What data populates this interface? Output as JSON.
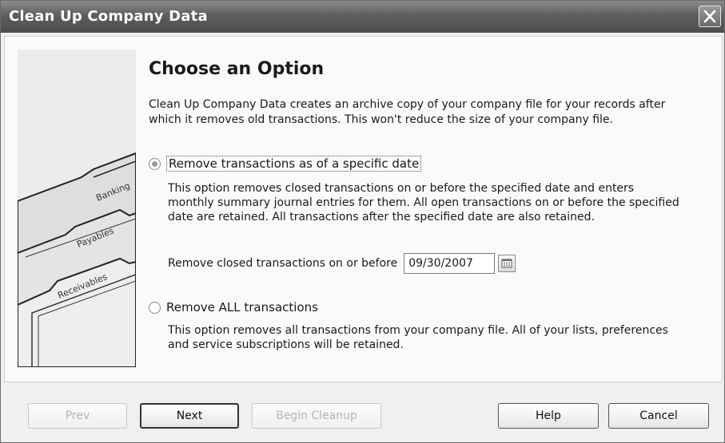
{
  "window": {
    "title": "Clean Up Company Data"
  },
  "heading": "Choose an Option",
  "description": "Clean Up Company Data creates an archive copy of your company file for your records after which it removes old transactions. This won't reduce the size of your company file.",
  "illustration": {
    "tabs": [
      "Banking",
      "Payables",
      "Receivables"
    ]
  },
  "options": [
    {
      "label": "Remove transactions as of a specific date",
      "selected": true,
      "text": "This option removes closed transactions on or before the specified date and enters monthly summary journal entries for them.  All open transactions on or before the specified date are retained.  All transactions after the specified date are also retained.",
      "date_label": "Remove closed transactions on or before",
      "date_value": "09/30/2007"
    },
    {
      "label": "Remove ALL transactions",
      "selected": false,
      "text": "This option removes all transactions from your company file.  All of your lists, preferences and service subscriptions will be retained."
    }
  ],
  "buttons": {
    "prev": "Prev",
    "next": "Next",
    "begin_cleanup": "Begin Cleanup",
    "help": "Help",
    "cancel": "Cancel"
  },
  "icons": {
    "close": "close-icon",
    "calendar": "calendar-icon"
  }
}
